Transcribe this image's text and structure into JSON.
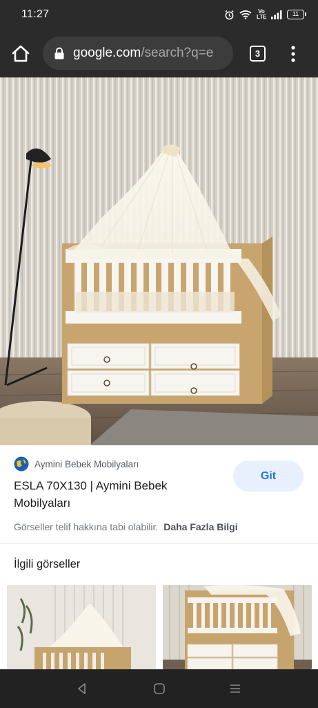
{
  "status_bar": {
    "time": "11:27",
    "lte_label": "Vo LTE",
    "battery": "11",
    "icons": [
      "alarm-icon",
      "wifi-icon",
      "volte-icon",
      "signal-icon",
      "battery-icon"
    ]
  },
  "toolbar": {
    "url_domain": "google.com",
    "url_path": "/search?q=e",
    "tab_count": "3",
    "icons": [
      "home-icon",
      "lock-icon",
      "tabs-icon",
      "more-vert-icon"
    ]
  },
  "result": {
    "image_alt": "ESLA 70X130 baby crib with canopy",
    "source_name": "Aymini Bebek Mobilyaları",
    "title": "ESLA 70X130 | Aymini Bebek Mobilyaları",
    "visit_label": "Git",
    "copyright_text": "Görseller telif hakkına tabi olabilir.",
    "more_info_label": "Daha Fazla Bilgi"
  },
  "related": {
    "heading": "İlgili görseller"
  },
  "nav_bar": {
    "icons": [
      "back-icon",
      "home-circle-icon",
      "recents-icon"
    ]
  },
  "colors": {
    "chrome": "#2b2b2b",
    "url_bar": "#3c3c3c",
    "accent": "#1a73e8",
    "accent_bg": "#e8f0fe",
    "crib_wood": "#c8a56e",
    "crib_white": "#f7f5f0"
  }
}
